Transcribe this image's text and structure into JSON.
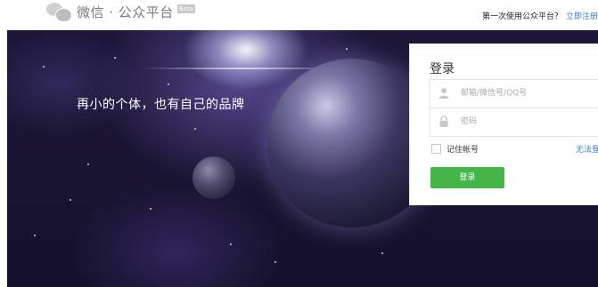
{
  "header": {
    "logo_title": "微信 · 公众平台",
    "beta_badge": "Beta",
    "first_time_text": "第一次使用公众平台？",
    "register_link": "立即注册"
  },
  "banner": {
    "slogan": "再小的个体，也有自己的品牌"
  },
  "login": {
    "title": "登录",
    "username_placeholder": "邮箱/微信号/QQ号",
    "password_placeholder": "密码",
    "remember_label": "记住帐号",
    "forgot_link": "无法登录？",
    "submit_label": "登录"
  },
  "icons": {
    "logo": "wechat-logo-icon",
    "user": "user-icon",
    "lock": "lock-icon"
  },
  "colors": {
    "accent_green": "#44b549",
    "link_blue": "#3b7bc9"
  }
}
